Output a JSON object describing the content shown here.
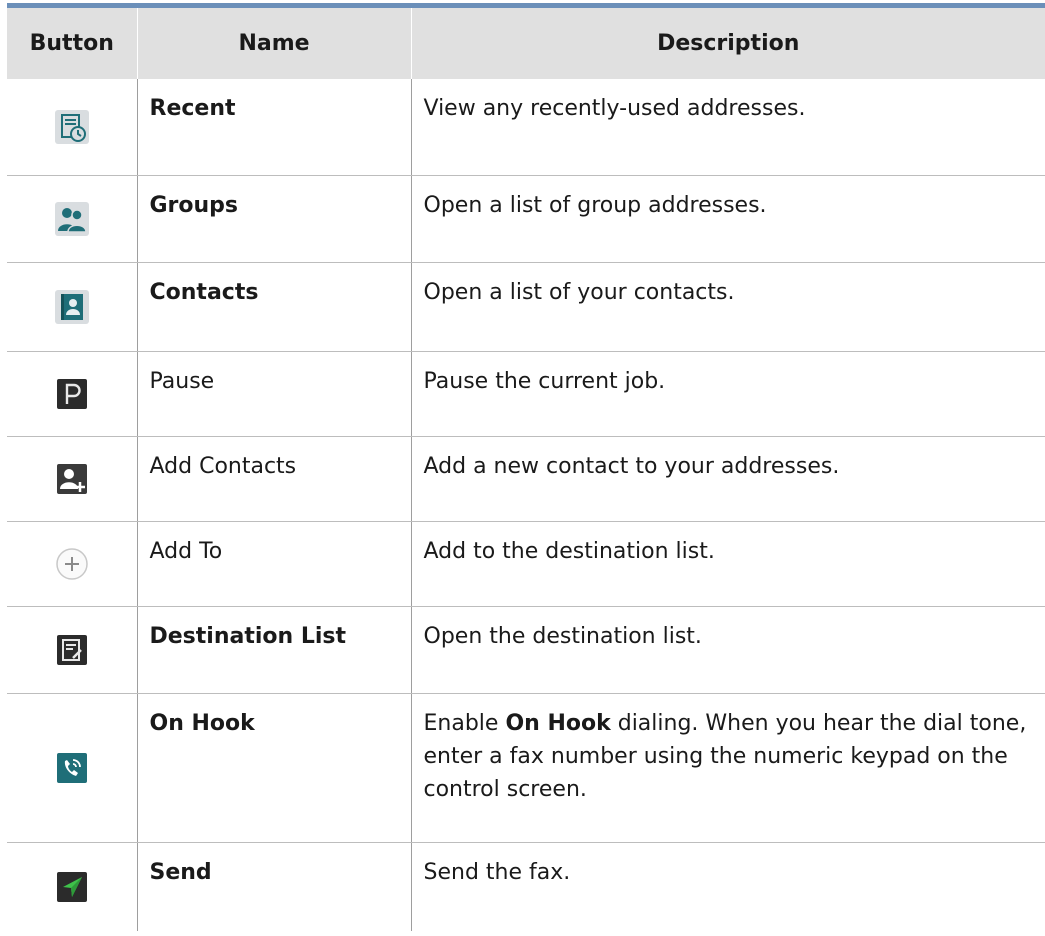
{
  "table": {
    "headers": {
      "button": "Button",
      "name": "Name",
      "description": "Description"
    },
    "rows": [
      {
        "icon": "recent-icon",
        "name": "Recent",
        "bold": true,
        "description": "View any recently-used addresses."
      },
      {
        "icon": "groups-icon",
        "name": "Groups",
        "bold": true,
        "description": "Open a list of group addresses."
      },
      {
        "icon": "contacts-icon",
        "name": "Contacts",
        "bold": true,
        "description": "Open a list of your contacts."
      },
      {
        "icon": "pause-icon",
        "name": "Pause",
        "bold": false,
        "description": "Pause the current job."
      },
      {
        "icon": "add-contacts-icon",
        "name": "Add Contacts",
        "bold": false,
        "description": "Add a new contact to your addresses."
      },
      {
        "icon": "add-to-icon",
        "name": "Add To",
        "bold": false,
        "description": "Add to the destination list."
      },
      {
        "icon": "destination-list-icon",
        "name": "Destination List",
        "bold": true,
        "description": "Open the destination list."
      },
      {
        "icon": "on-hook-icon",
        "name": "On Hook",
        "bold": true,
        "description_prefix": "Enable ",
        "description_bold": "On Hook",
        "description_suffix": " dialing. When you hear the dial tone, enter a fax number using the numeric keypad on the control screen."
      },
      {
        "icon": "send-icon",
        "name": "Send",
        "bold": true,
        "description": "Send the fax."
      }
    ]
  },
  "colors": {
    "header_background": "#e0e0e0",
    "header_rule": "#6b8fb9",
    "row_divider": "#bdbdbd",
    "icon_teal": "#1f6e78",
    "send_green": "#3ec24a",
    "dark_icon": "#2b2b2b"
  }
}
